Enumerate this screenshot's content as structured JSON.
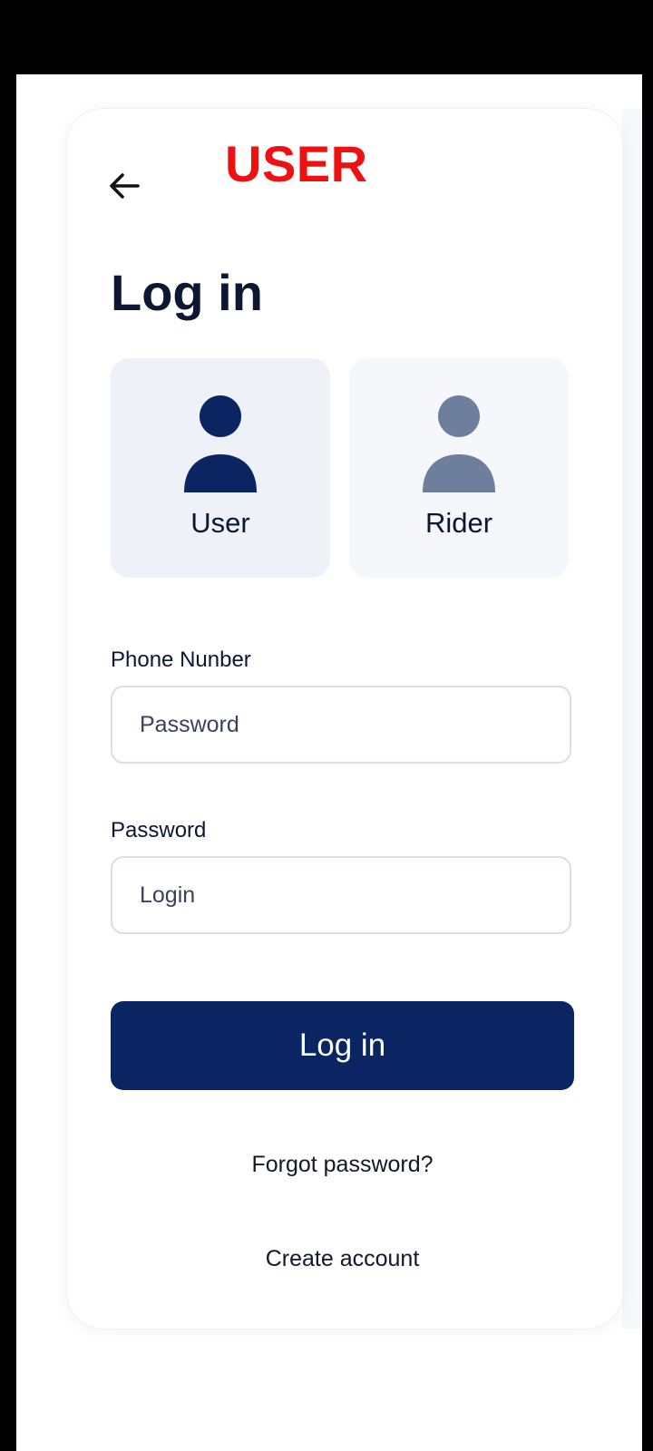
{
  "header": {
    "banner": "USER",
    "title": "Log in"
  },
  "roles": [
    {
      "label": "User",
      "selected": true,
      "icon": "person-icon"
    },
    {
      "label": "Rider",
      "selected": false,
      "icon": "person-icon"
    }
  ],
  "form": {
    "phone": {
      "label": "Phone Nunber",
      "value": "Password"
    },
    "password": {
      "label": "Password",
      "value": "Login"
    }
  },
  "actions": {
    "login_label": "Log in",
    "forgot_label": "Forgot password?",
    "create_label": "Create account"
  },
  "colors": {
    "brand": "#0b2563",
    "banner": "#ee1111",
    "selected_icon": "#0b2563",
    "unselected_icon": "#6e7f9e"
  },
  "icons": {
    "back": "arrow-left-icon"
  }
}
